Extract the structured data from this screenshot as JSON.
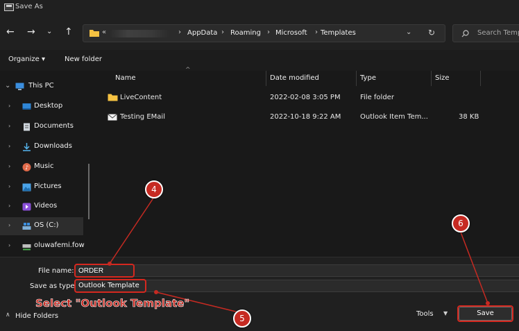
{
  "window": {
    "title": "Save As"
  },
  "address": {
    "prefix_glyph": "«",
    "crumbs": [
      "AppData",
      "Roaming",
      "Microsoft",
      "Templates"
    ],
    "separator": "›"
  },
  "search": {
    "placeholder": "Search Temp"
  },
  "toolbar": {
    "organize_label": "Organize ▾",
    "new_folder_label": "New folder"
  },
  "sidebar": {
    "items": [
      {
        "label": "This PC",
        "icon": "monitor-icon",
        "color": "#3b8ede"
      },
      {
        "label": "Desktop",
        "icon": "desktop-icon",
        "color": "#2f86d6"
      },
      {
        "label": "Documents",
        "icon": "document-icon",
        "color": "#cfd6dd"
      },
      {
        "label": "Downloads",
        "icon": "download-icon",
        "color": "#56b6f0"
      },
      {
        "label": "Music",
        "icon": "music-icon",
        "color": "#e06a4a"
      },
      {
        "label": "Pictures",
        "icon": "picture-icon",
        "color": "#4aa3e8"
      },
      {
        "label": "Videos",
        "icon": "video-icon",
        "color": "#8a4fd8"
      },
      {
        "label": "OS (C:)",
        "icon": "drive-icon",
        "color": "#7fb0d9"
      },
      {
        "label": "oluwafemi.fow",
        "icon": "network-drive-icon",
        "color": "#4caf50"
      }
    ]
  },
  "filelist": {
    "columns": [
      "Name",
      "Date modified",
      "Type",
      "Size"
    ],
    "rows": [
      {
        "name": "LiveContent",
        "date": "2022-02-08 3:05 PM",
        "type": "File folder",
        "size": "",
        "icon": "folder-icon"
      },
      {
        "name": "Testing EMail",
        "date": "2022-10-18 9:22 AM",
        "type": "Outlook Item Tem...",
        "size": "38 KB",
        "icon": "mail-icon"
      }
    ]
  },
  "form": {
    "filename_label": "File name:",
    "filename_value": "ORDER",
    "savetype_label": "Save as type:",
    "savetype_value": "Outlook Template"
  },
  "footer": {
    "hide_folders_label": "Hide Folders",
    "tools_label": "Tools",
    "save_label": "Save"
  },
  "annotations": {
    "step_4": "4",
    "step_5": "5",
    "step_6": "6",
    "instruction": "Select \"Outlook Template\"",
    "color": "#c62a22"
  }
}
